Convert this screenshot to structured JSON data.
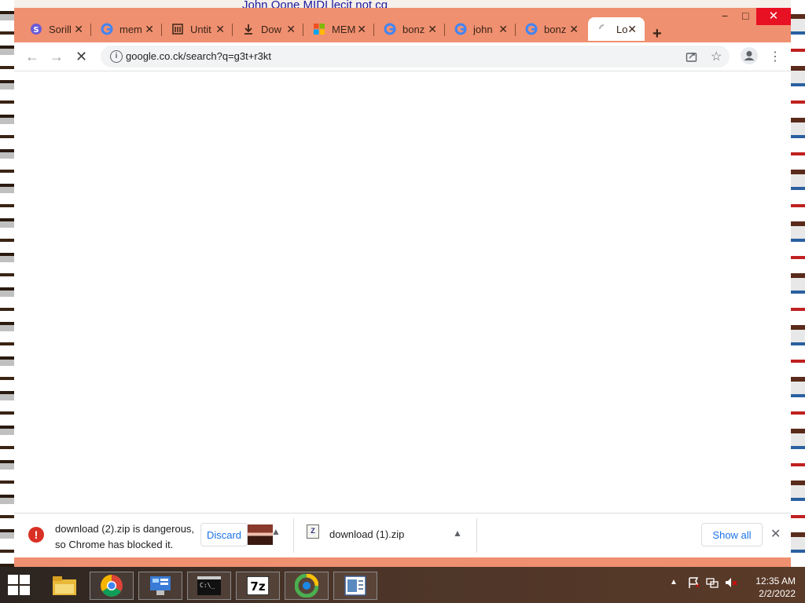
{
  "desktop": {
    "snippet_text": "John Oone MIDI lecit not cq"
  },
  "window": {
    "controls": {
      "minimize": "−",
      "maximize": "□",
      "close": "✕"
    }
  },
  "tabs": [
    {
      "label": "Sorill",
      "icon": "sorill-icon"
    },
    {
      "label": "mem",
      "icon": "google-icon"
    },
    {
      "label": "Untit",
      "icon": "document-icon"
    },
    {
      "label": "Dow",
      "icon": "download-icon"
    },
    {
      "label": "MEM",
      "icon": "microsoft-icon"
    },
    {
      "label": "bonz",
      "icon": "google-icon"
    },
    {
      "label": "john",
      "icon": "google-icon"
    },
    {
      "label": "bonz",
      "icon": "google-icon"
    },
    {
      "label": "Lo",
      "icon": "loading-icon",
      "active": true
    }
  ],
  "new_tab": "+",
  "toolbar": {
    "back": "←",
    "forward": "→",
    "stop": "✕",
    "url": "google.co.ck/search?q=g3t+r3kt",
    "menu": "⋮"
  },
  "shelf": {
    "warning_line1": "download (2).zip is dangerous,",
    "warning_line2": "so Chrome has blocked it.",
    "discard": "Discard",
    "download1": "download (1).zip",
    "show_all": "Show all",
    "close": "✕"
  },
  "taskbar": {
    "items": [
      "file-explorer",
      "chrome",
      "control-panel",
      "command-prompt",
      "7zip",
      "installer",
      "document-viewer"
    ],
    "icons": {
      "cmd": "C:\\_",
      "sevenzip": "7z"
    }
  },
  "clock": {
    "time": "12:35 AM",
    "date": "2/2/2022"
  },
  "colors": {
    "tab_strip": "#ef9070",
    "close": "#e81123",
    "link": "#1a73e8",
    "danger": "#d93025"
  }
}
